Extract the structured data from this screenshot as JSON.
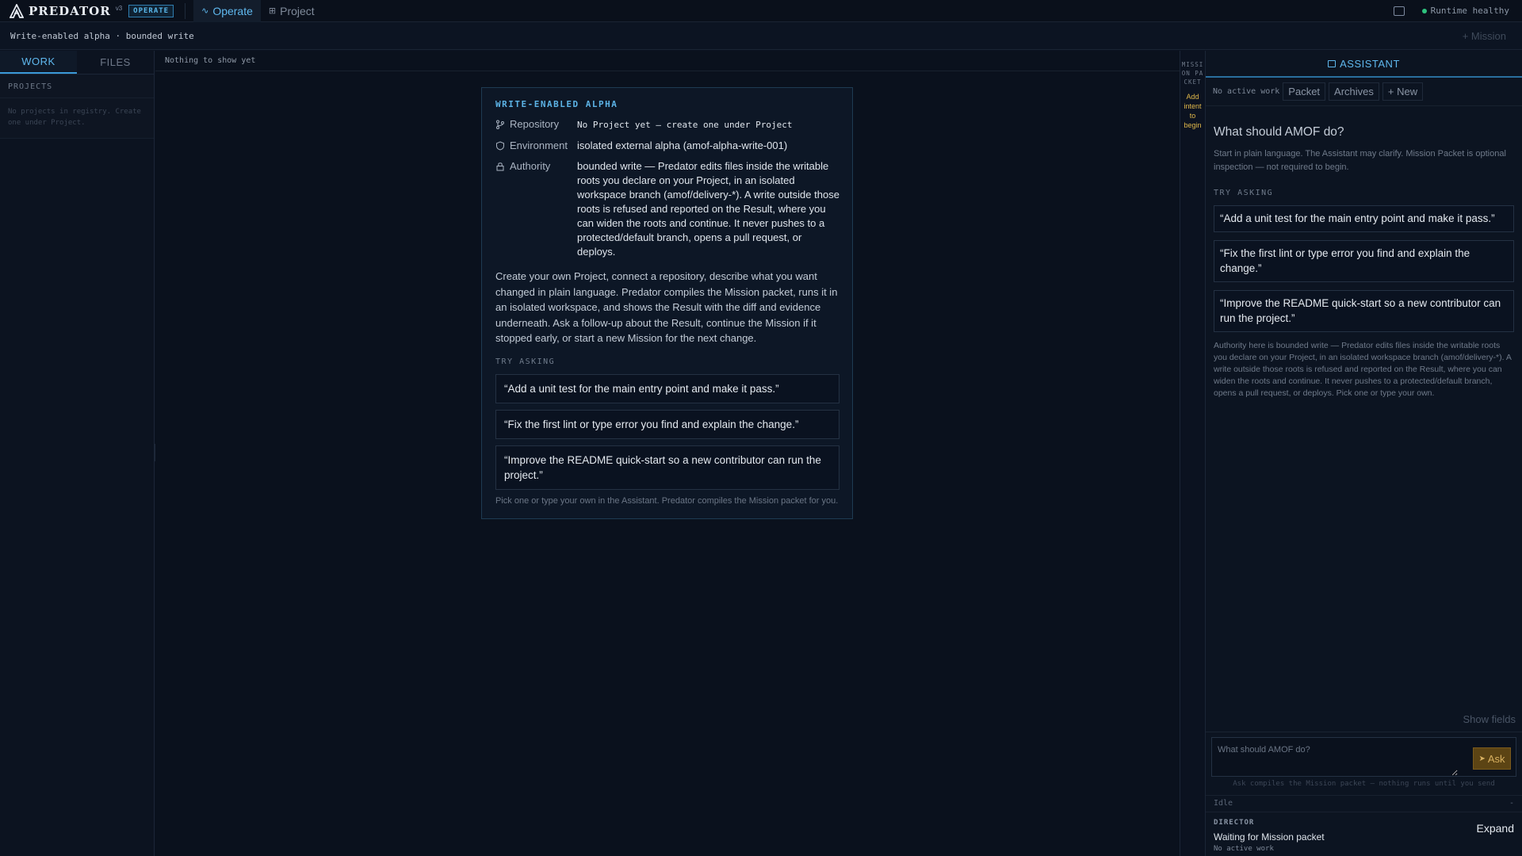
{
  "topbar": {
    "brand": "PREDATOR",
    "version": "v3",
    "mode_badge": "OPERATE",
    "tabs": [
      {
        "label": "Operate",
        "icon": "activity-icon",
        "active": true
      },
      {
        "label": "Project",
        "icon": "grid-icon",
        "active": false
      }
    ],
    "runtime_status": "Runtime healthy",
    "status_color": "#2ec27e"
  },
  "subbar": {
    "title": "Write-enabled alpha · bounded write",
    "new_mission": "+ Mission"
  },
  "left_sidebar": {
    "tabs": [
      {
        "label": "WORK",
        "active": true
      },
      {
        "label": "FILES",
        "active": false
      }
    ],
    "projects_header": "PROJECTS",
    "projects_empty": "No projects in registry. Create one under Project."
  },
  "main": {
    "empty_text": "Nothing to show yet",
    "card": {
      "title": "WRITE-ENABLED ALPHA",
      "rows": [
        {
          "label": "Repository",
          "icon": "git-branch-icon",
          "value": "No Project yet — create one under Project"
        },
        {
          "label": "Environment",
          "icon": "shield-icon",
          "value": "isolated external alpha (amof-alpha-write-001)"
        },
        {
          "label": "Authority",
          "icon": "lock-icon",
          "value": "bounded write — Predator edits files inside the writable roots you declare on your Project, in an isolated workspace branch (amof/delivery-*). A write outside those roots is refused and reported on the Result, where you can widen the roots and continue. It never pushes to a protected/default branch, opens a pull request, or deploys."
        }
      ],
      "description": "Create your own Project, connect a repository, describe what you want changed in plain language. Predator compiles the Mission packet, runs it in an isolated workspace, and shows the Result with the diff and evidence underneath. Ask a follow-up about the Result, continue the Mission if it stopped early, or start a new Mission for the next change.",
      "try_label": "TRY ASKING",
      "suggestions": [
        "“Add a unit test for the main entry point and make it pass.”",
        "“Fix the first lint or type error you find and explain the change.”",
        "“Improve the README quick-start so a new contributor can run the project.”"
      ],
      "footnote": "Pick one or type your own in the Assistant. Predator compiles the Mission packet for you."
    }
  },
  "packet_rail": {
    "label": "MISSION PACKET",
    "hint": "Add intent to begin",
    "hint_color": "#e0b84a"
  },
  "assistant": {
    "header": "ASSISTANT",
    "no_active_work": "No active work",
    "buttons": {
      "packet": "Packet",
      "archives": "Archives",
      "new": "+ New"
    },
    "question": "What should AMOF do?",
    "intro": "Start in plain language. The Assistant may clarify. Mission Packet is optional inspection — not required to begin.",
    "try_label": "TRY ASKING",
    "suggestions": [
      "“Add a unit test for the main entry point and make it pass.”",
      "“Fix the first lint or type error you find and explain the change.”",
      "“Improve the README quick-start so a new contributor can run the project.”"
    ],
    "authority": "Authority here is bounded write — Predator edits files inside the writable roots you declare on your Project, in an isolated workspace branch (amof/delivery-*). A write outside those roots is refused and reported on the Result, where you can widen the roots and continue. It never pushes to a protected/default branch, opens a pull request, or deploys. Pick one or type your own.",
    "show_fields": "Show fields",
    "ask_placeholder": "What should AMOF do?",
    "ask_button": "Ask",
    "ask_hint": "Ask compiles the Mission packet — nothing runs until you send",
    "idle": "Idle",
    "idle_dash": "-",
    "director": {
      "label": "DIRECTOR",
      "status": "Waiting for Mission packet",
      "sub": "No active work",
      "expand": "Expand"
    }
  }
}
